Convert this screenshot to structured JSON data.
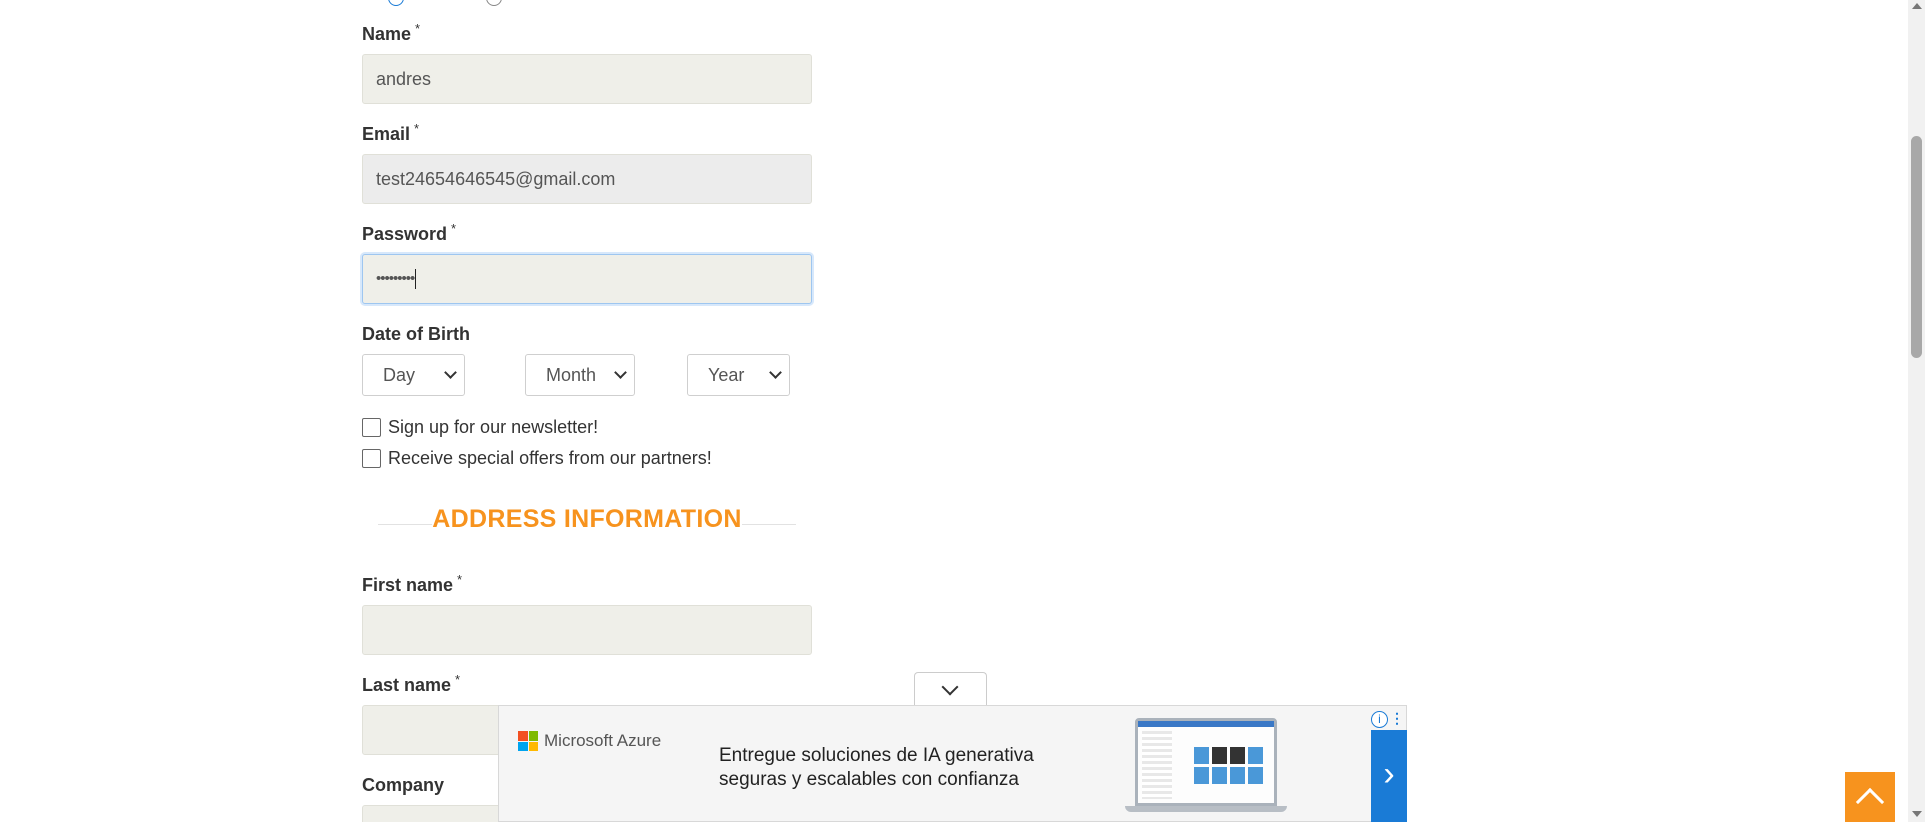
{
  "form": {
    "name": {
      "label": "Name",
      "required_mark": "*",
      "value": "andres"
    },
    "email": {
      "label": "Email",
      "required_mark": "*",
      "value": "test24654646545@gmail.com"
    },
    "password": {
      "label": "Password",
      "required_mark": "*",
      "masked_value": "•••••••••"
    },
    "dob": {
      "label": "Date of Birth",
      "day": "Day",
      "month": "Month",
      "year": "Year"
    },
    "newsletter_label": "Sign up for our newsletter!",
    "offers_label": "Receive special offers from our partners!"
  },
  "address": {
    "section_title": "ADDRESS INFORMATION",
    "first_name": {
      "label": "First name",
      "required_mark": "*",
      "value": ""
    },
    "last_name": {
      "label": "Last name",
      "required_mark": "*",
      "value": ""
    },
    "company": {
      "label": "Company"
    }
  },
  "ad": {
    "brand": "Microsoft Azure",
    "line1": "Entregue soluciones de IA generativa",
    "line2": "seguras y escalables con confianza",
    "info_glyph": "i",
    "menu_glyph": "⋮",
    "cta_glyph": "›",
    "colors": {
      "ms_red": "#f25022",
      "ms_green": "#7fba00",
      "ms_blue": "#00a4ef",
      "ms_yellow": "#ffb900",
      "cta": "#1a7bd6"
    }
  },
  "colors": {
    "accent": "#f7931e",
    "input_bg": "#efefe9"
  }
}
